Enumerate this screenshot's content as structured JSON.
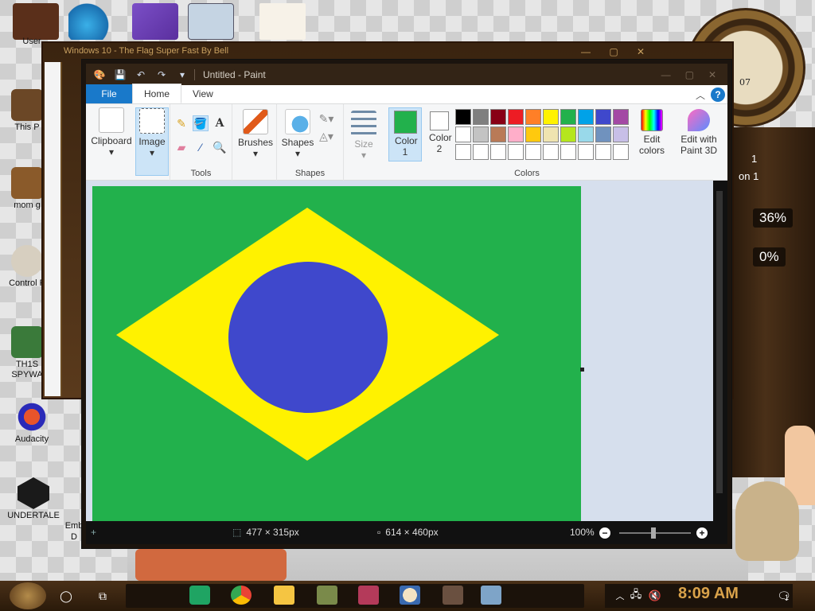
{
  "desktop": {
    "icons": [
      {
        "label": "User"
      },
      {
        "label": "This P"
      },
      {
        "label": "mom g"
      },
      {
        "label": "Control P"
      },
      {
        "label": "TH1S SPYWA"
      },
      {
        "label": "Audacity"
      },
      {
        "label": "UNDERTALE"
      },
      {
        "label": "Emb D"
      }
    ],
    "widget": {
      "clock_number": "07",
      "cpu_percent": "36%",
      "mem_percent": "0%",
      "side_label_1": "1",
      "side_label_2": "on 1"
    }
  },
  "back_window": {
    "title": "Windows 10 - The Flag Super Fast By Bell"
  },
  "paint": {
    "title": "Untitled - Paint",
    "tabs": {
      "file": "File",
      "home": "Home",
      "view": "View"
    },
    "help": "?",
    "ribbon": {
      "clipboard": "Clipboard",
      "image": "Image",
      "tools_group": "Tools",
      "brushes": "Brushes",
      "shapes": "Shapes",
      "shapes_group": "Shapes",
      "size": "Size",
      "color1": "Color 1",
      "color2": "Color 2",
      "colors_group": "Colors",
      "edit_colors": "Edit colors",
      "edit_with_3d": "Edit with Paint 3D"
    },
    "colors": {
      "color1": "#22b14c",
      "color2": "#ffffff",
      "palette_row1": [
        "#000000",
        "#7f7f7f",
        "#880015",
        "#ed1c24",
        "#ff7f27",
        "#fff200",
        "#22b14c",
        "#00a2e8",
        "#3f48cc",
        "#a349a4"
      ],
      "palette_row2": [
        "#ffffff",
        "#c3c3c3",
        "#b97a57",
        "#ffaec9",
        "#ffc90e",
        "#efe4b0",
        "#b5e61d",
        "#99d9ea",
        "#7092be",
        "#c8bfe7"
      ],
      "palette_row3": [
        "#ffffff",
        "#ffffff",
        "#ffffff",
        "#ffffff",
        "#ffffff",
        "#ffffff",
        "#ffffff",
        "#ffffff",
        "#ffffff",
        "#ffffff"
      ]
    },
    "canvas": {
      "background": "#22b14c",
      "diamond": "#fff200",
      "circle": "#3f48cc"
    },
    "status": {
      "cursor_pos": "477 × 315px",
      "canvas_size": "614 × 460px",
      "zoom": "100%"
    }
  },
  "taskbar": {
    "time": "8:09 AM",
    "notification_count": "1"
  }
}
